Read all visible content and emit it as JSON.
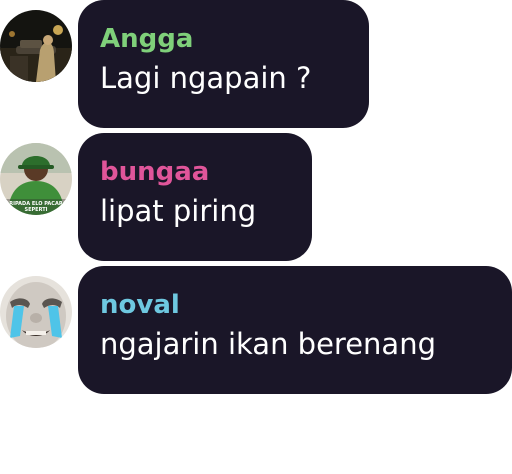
{
  "messages": [
    {
      "name": "Angga",
      "name_color": "#7fd07a",
      "text": "Lagi ngapain ?",
      "avatar_icon": "night-street-avatar-icon"
    },
    {
      "name": "bungaa",
      "name_color": "#e0559a",
      "text": "lipat piring",
      "avatar_icon": "gta-character-meme-avatar-icon",
      "avatar_caption": "DARIPADA ELO PACARAN SEPERTI"
    },
    {
      "name": "noval",
      "name_color": "#6ec8e0",
      "text": "ngajarin ikan berenang",
      "avatar_icon": "crying-face-meme-avatar-icon"
    }
  ],
  "colors": {
    "bubble": "#1a1628",
    "text": "#ffffff",
    "background": "#ffffff"
  }
}
